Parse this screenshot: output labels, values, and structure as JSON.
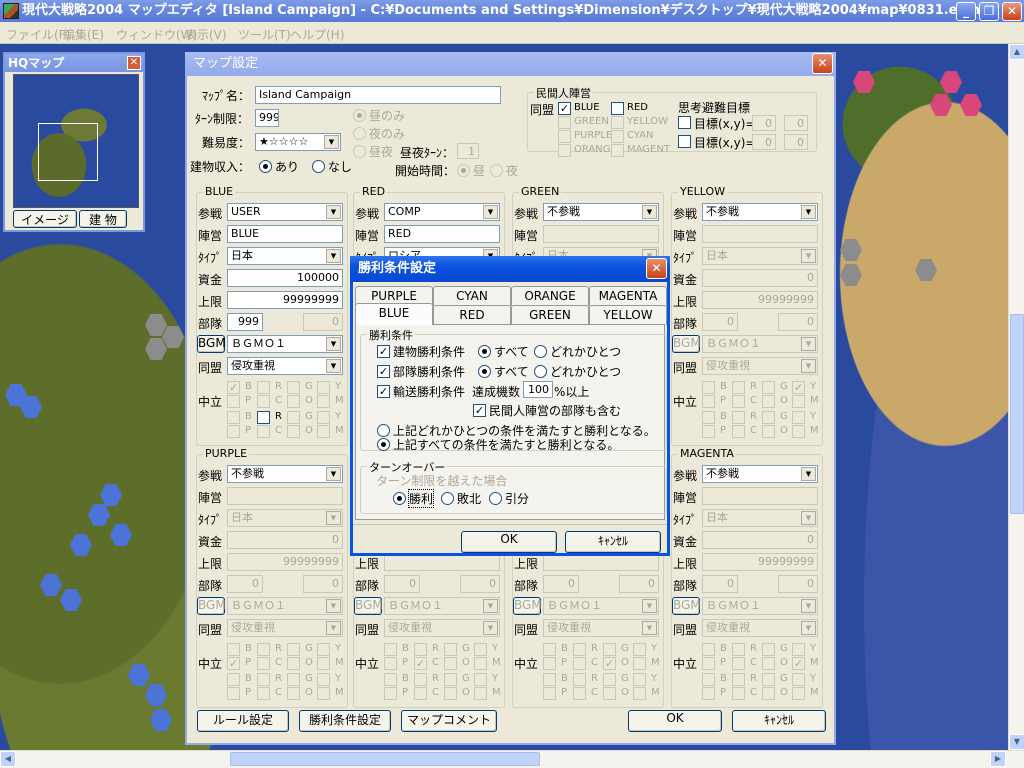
{
  "app": {
    "title": "現代大戦略2004 マップエディタ [Island Campaign] - C:¥Documents and Settings¥Dimension¥デスクトップ¥現代大戦略2004¥map¥0831.e2m",
    "menu": [
      "ファイル(F)",
      "編集(E)",
      "ウィンドウ(W)",
      "表示(V)",
      "ツール(T)",
      "ヘルプ(H)"
    ],
    "window_buttons": {
      "minimize": "_",
      "maximize": "❐",
      "close": "✕"
    }
  },
  "hq": {
    "title": "HQマップ",
    "close": "✕",
    "image_button": "イメージ",
    "building_button": "建 物"
  },
  "dialog": {
    "title": "マップ設定",
    "close": "✕",
    "map_name_label": "ﾏｯﾌﾟ名：",
    "map_name": "Island Campaign",
    "turn_limit_label": "ﾀｰﾝ制限：",
    "turn_limit": "999",
    "difficulty_label": "難易度：",
    "difficulty": "★☆☆☆☆",
    "building_income_label": "建物収入：",
    "income_yes": "あり",
    "income_no": "なし",
    "income_selected": "あり",
    "day_only": "昼のみ",
    "night_only": "夜のみ",
    "day_night": "昼夜",
    "day_night_turn_label": "昼夜ﾀｰﾝ：",
    "day_night_turn": "1",
    "start_time_label": "開始時間：",
    "start_day": "昼",
    "start_night": "夜",
    "civilian": {
      "title": "民間人陣営",
      "alliance_label": "同盟",
      "teams": [
        {
          "name": "BLUE",
          "checked": true,
          "enabled": true
        },
        {
          "name": "RED",
          "checked": false,
          "enabled": true
        },
        {
          "name": "GREEN",
          "checked": false,
          "enabled": false
        },
        {
          "name": "YELLOW",
          "checked": false,
          "enabled": false
        },
        {
          "name": "PURPLE",
          "checked": false,
          "enabled": false
        },
        {
          "name": "CYAN",
          "checked": false,
          "enabled": false
        },
        {
          "name": "ORANGE",
          "checked": false,
          "enabled": false
        },
        {
          "name": "MAGENT",
          "checked": false,
          "enabled": false
        }
      ],
      "evac_title": "思考避難目標",
      "target_label": "目標(x,y)=",
      "targets": [
        [
          "0",
          "0"
        ],
        [
          "0",
          "0"
        ]
      ]
    },
    "field_labels": {
      "join": "参戦",
      "camp": "陣営",
      "type": "ﾀｲﾌﾟ",
      "funds": "資金",
      "limit": "上限",
      "units": "部隊",
      "bgm": "BGM",
      "alliance": "同盟",
      "neutral": "中立"
    },
    "neutral_letters": [
      [
        "B",
        "R",
        "G",
        "Y"
      ],
      [
        "P",
        "C",
        "O",
        "M"
      ]
    ],
    "teams": [
      {
        "name": "BLUE",
        "enabled": true,
        "join": "USER",
        "camp": "BLUE",
        "type": "日本",
        "funds": "100000",
        "limit": "99999999",
        "units": "999",
        "units2": "0",
        "bgm": "ＢＧＭＯ１",
        "alliance": "侵攻重視",
        "neutral_checked": "B",
        "second_enabled": "R"
      },
      {
        "name": "RED",
        "enabled": true,
        "join": "COMP",
        "camp": "RED",
        "type": "ロシア"
      },
      {
        "name": "GREEN",
        "enabled": false,
        "join": "不参戦",
        "camp": "",
        "type": "日本"
      },
      {
        "name": "YELLOW",
        "enabled": false,
        "join": "不参戦",
        "camp": "",
        "type": "日本",
        "funds": "0",
        "limit": "99999999",
        "units": "0",
        "units2": "0",
        "bgm": "ＢＧＭＯ１",
        "alliance": "侵攻重視",
        "neutral_checked": "Y"
      },
      {
        "name": "PURPLE",
        "enabled": false,
        "join": "不参戦",
        "camp": "",
        "type": "日本",
        "funds": "0",
        "limit": "99999999",
        "units": "0",
        "units2": "0",
        "bgm": "ＢＧＭＯ１",
        "alliance": "侵攻重視",
        "neutral_checked": "P"
      },
      {
        "name": "",
        "enabled": false,
        "units": "0",
        "units2": "0",
        "bgm": "ＢＧＭＯ１",
        "alliance": "侵攻重視",
        "neutral_checked": "C"
      },
      {
        "name": "",
        "enabled": false,
        "units": "0",
        "units2": "0",
        "bgm": "ＢＧＭＯ１",
        "alliance": "侵攻重視",
        "neutral_checked": "O"
      },
      {
        "name": "MAGENTA",
        "enabled": false,
        "join": "不参戦",
        "camp": "",
        "type": "日本",
        "funds": "0",
        "limit": "99999999",
        "units": "0",
        "units2": "0",
        "bgm": "ＢＧＭＯ１",
        "alliance": "侵攻重視",
        "neutral_checked": "M"
      }
    ],
    "buttons": {
      "rules": "ルール設定",
      "victory": "勝利条件設定",
      "comment": "マップコメント",
      "ok": "OK",
      "cancel": "ｷｬﾝｾﾙ"
    }
  },
  "victory": {
    "title": "勝利条件設定",
    "close": "✕",
    "tabs_back": [
      "PURPLE",
      "CYAN",
      "ORANGE",
      "MAGENTA"
    ],
    "tabs_front": [
      "BLUE",
      "RED",
      "GREEN",
      "YELLOW"
    ],
    "active_tab": "BLUE",
    "conditions_title": "勝利条件",
    "building": "建物勝利条件",
    "unit": "部隊勝利条件",
    "all": "すべて",
    "any": "どれかひとつ",
    "transport": "輸送勝利条件",
    "achieve_label": "達成機数",
    "achieve_value": "100",
    "achieve_suffix": "%以上",
    "include_civilian": "民間人陣営の部隊も含む",
    "any_cond": "上記どれかひとつの条件を満たすと勝利となる。",
    "all_cond": "上記すべての条件を満たすと勝利となる。",
    "turnover_title": "ターンオーバー",
    "turnover_sub": "ターン制限を越えた場合",
    "win": "勝利",
    "lose": "敗北",
    "draw": "引分",
    "turnover_selected": "勝利",
    "ok": "OK",
    "cancel": "ｷｬﾝｾﾙ"
  }
}
